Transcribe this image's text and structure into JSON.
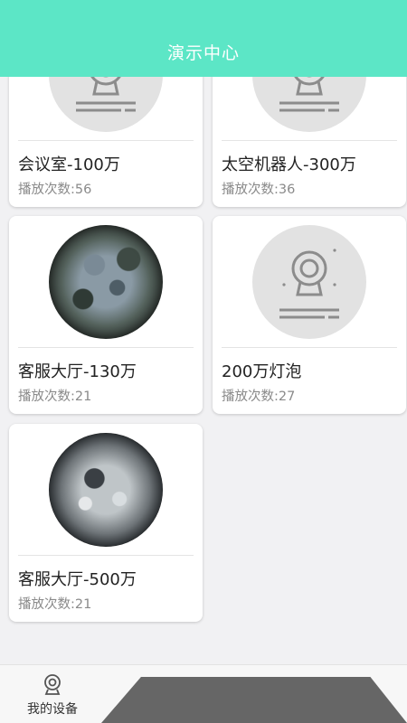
{
  "header": {
    "title": "演示中心"
  },
  "devices": [
    {
      "title": "会议室-100万",
      "plays": "播放次数:56",
      "thumb": "camera-placeholder-icon"
    },
    {
      "title": "太空机器人-300万",
      "plays": "播放次数:36",
      "thumb": "camera-placeholder-icon"
    },
    {
      "title": "客服大厅-130万",
      "plays": "播放次数:21",
      "thumb": "fisheye-sphere-image"
    },
    {
      "title": "200万灯泡",
      "plays": "播放次数:27",
      "thumb": "camera-placeholder-icon"
    },
    {
      "title": "客服大厅-500万",
      "plays": "播放次数:21",
      "thumb": "fisheye-lens-image"
    }
  ],
  "bottom_nav": {
    "my_devices_label": "我的设备",
    "my_devices_icon": "camera-icon"
  },
  "colors": {
    "header": "#5ce6c6",
    "background": "#f1f1f3",
    "card": "#ffffff",
    "subtext": "#8a8a8a"
  }
}
